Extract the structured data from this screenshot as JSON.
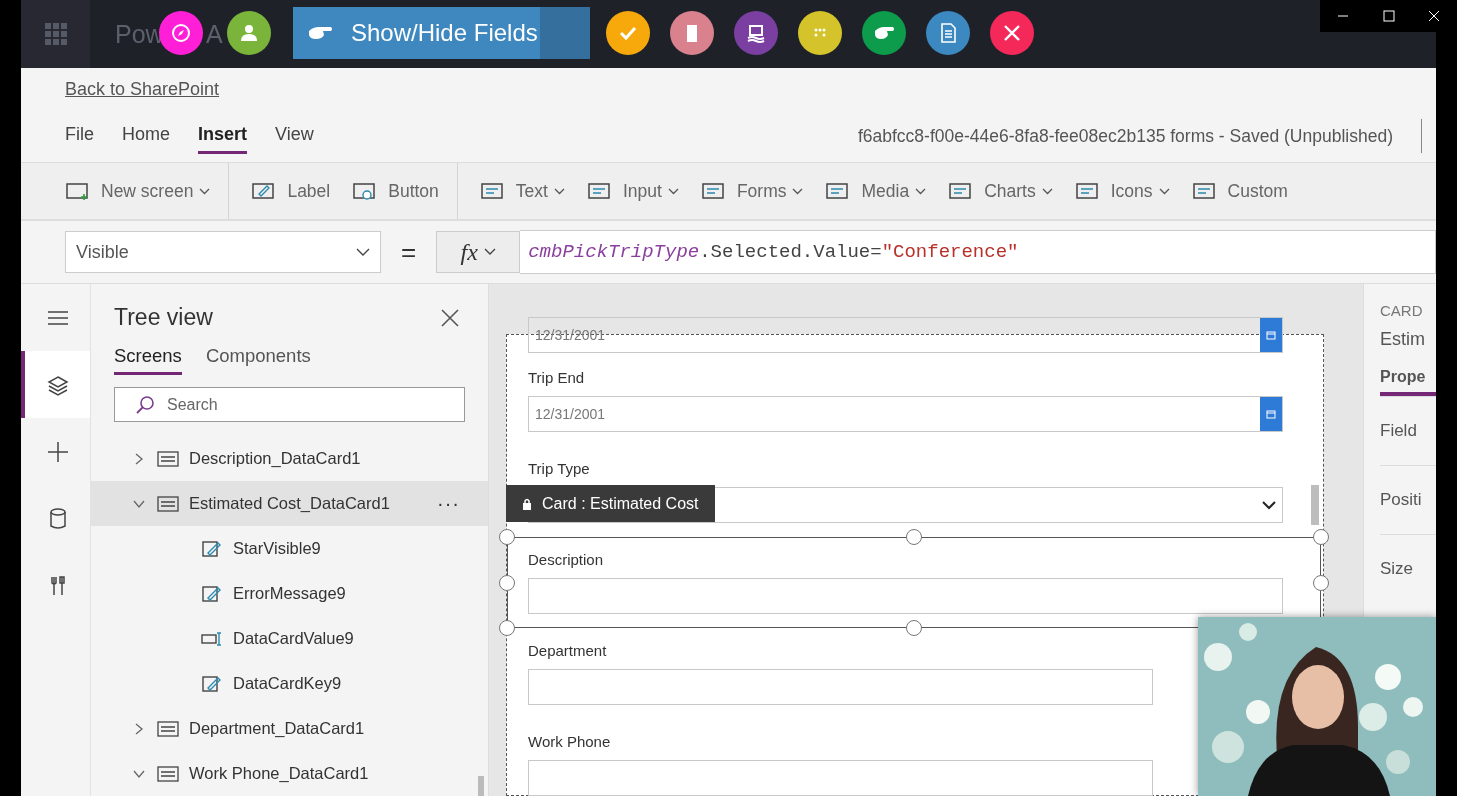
{
  "app_title": {
    "fragments": [
      "Pow",
      "A"
    ]
  },
  "overlay_toolbar": {
    "lead_tools": [
      {
        "color": "#ff1fd6"
      },
      {
        "color": "#7bb43a"
      }
    ],
    "active_tool": {
      "label": "Show/Hide Fields"
    },
    "tools": [
      {
        "color": "#f7a90c"
      },
      {
        "color": "#d9828e"
      },
      {
        "color": "#7a3fa0"
      },
      {
        "color": "#d4c32a"
      },
      {
        "color": "#0d9c4c"
      },
      {
        "color": "#3c88c0"
      },
      {
        "color": "#f5285a"
      }
    ]
  },
  "back_link": "Back to SharePoint",
  "menu": [
    {
      "label": "File",
      "selected": false
    },
    {
      "label": "Home",
      "selected": false
    },
    {
      "label": "Insert",
      "selected": true
    },
    {
      "label": "View",
      "selected": false
    }
  ],
  "document_title": "f6abfcc8-f00e-44e6-8fa8-fee08ec2b135 forms - Saved (Unpublished)",
  "ribbon": [
    {
      "label": "New screen",
      "dropdown": true,
      "divider": true
    },
    {
      "label": "Label",
      "dropdown": false,
      "divider": false
    },
    {
      "label": "Button",
      "dropdown": false,
      "divider": true
    },
    {
      "label": "Text",
      "dropdown": true,
      "divider": false
    },
    {
      "label": "Input",
      "dropdown": true,
      "divider": false
    },
    {
      "label": "Forms",
      "dropdown": true,
      "divider": false
    },
    {
      "label": "Media",
      "dropdown": true,
      "divider": false
    },
    {
      "label": "Charts",
      "dropdown": true,
      "divider": false
    },
    {
      "label": "Icons",
      "dropdown": true,
      "divider": false
    },
    {
      "label": "Custom",
      "dropdown": false,
      "divider": false
    }
  ],
  "formula_bar": {
    "property": "Visible",
    "equals": "=",
    "fx": "fx",
    "formula": [
      {
        "kind": "identifier",
        "text": "cmbPickTripType"
      },
      {
        "kind": "plain",
        "text": ".Selected.Value="
      },
      {
        "kind": "string",
        "text": "\"Conference\""
      }
    ]
  },
  "rail": [
    {
      "selected": false
    },
    {
      "selected": true
    },
    {
      "selected": false
    },
    {
      "selected": false
    },
    {
      "selected": false
    }
  ],
  "tree_view": {
    "title": "Tree view",
    "tabs": [
      {
        "label": "Screens",
        "selected": true
      },
      {
        "label": "Components",
        "selected": false
      }
    ],
    "search": {
      "placeholder": "Search"
    },
    "items": [
      {
        "label": "Description_DataCard1",
        "kind": "card",
        "expanded": false,
        "selected": false
      },
      {
        "label": "Estimated Cost_DataCard1",
        "kind": "card",
        "expanded": true,
        "selected": true,
        "more": "···",
        "children": [
          {
            "label": "StarVisible9",
            "kind": "edit",
            "selected": false
          },
          {
            "label": "ErrorMessage9",
            "kind": "edit",
            "selected": false
          },
          {
            "label": "DataCardValue9",
            "kind": "input",
            "selected": false
          },
          {
            "label": "DataCardKey9",
            "kind": "edit",
            "selected": false
          }
        ]
      },
      {
        "label": "Department_DataCard1",
        "kind": "card",
        "expanded": false,
        "selected": false
      },
      {
        "label": "Work Phone_DataCard1",
        "kind": "card",
        "expanded": true,
        "selected": false
      }
    ]
  },
  "form": {
    "tooltip": "Card : Estimated Cost",
    "fields": [
      {
        "kind": "date",
        "value": "12/31/2001",
        "selected": false
      },
      {
        "label": "Trip End",
        "kind": "date",
        "value": "12/31/2001",
        "selected": false
      },
      {
        "label": "Trip Type",
        "kind": "dropdown",
        "selected": false
      },
      {
        "label": "Description",
        "kind": "text",
        "selected": true
      },
      {
        "label": "Department",
        "kind": "text",
        "selected": false
      },
      {
        "label": "Work Phone",
        "kind": "text",
        "selected": false
      }
    ]
  },
  "properties_panel": {
    "type": "CARD",
    "name": "Estim",
    "tabs": [
      {
        "label": "Prope",
        "selected": true
      }
    ],
    "rows": [
      "Field",
      "Positi",
      "Size"
    ]
  }
}
